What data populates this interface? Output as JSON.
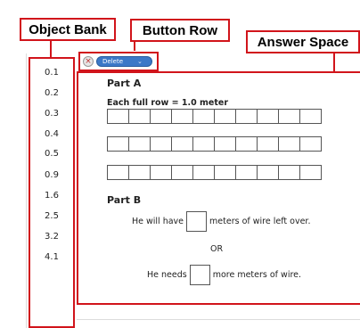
{
  "callouts": {
    "object_bank": "Object Bank",
    "button_row": "Button Row",
    "answer_space": "Answer Space"
  },
  "object_bank": {
    "items": [
      "0.1",
      "0.2",
      "0.3",
      "0.4",
      "0.5",
      "0.9",
      "1.6",
      "2.5",
      "3.2",
      "4.1"
    ]
  },
  "toolbar": {
    "delete_label": "Delete",
    "close_icon": "close-circle-icon",
    "dropdown_icon": "chevron-down-icon"
  },
  "answer": {
    "part_a_title": "Part A",
    "part_a_subtitle": "Each full row = 1.0 meter",
    "part_b_title": "Part B",
    "sentence1_before": "He will have",
    "sentence1_after": "meters of wire left over.",
    "or_label": "OR",
    "sentence2_before": "He needs",
    "sentence2_after": "more meters of wire."
  },
  "colors": {
    "annotation_red": "#d1141b",
    "delete_button_blue": "#3b78c7"
  }
}
